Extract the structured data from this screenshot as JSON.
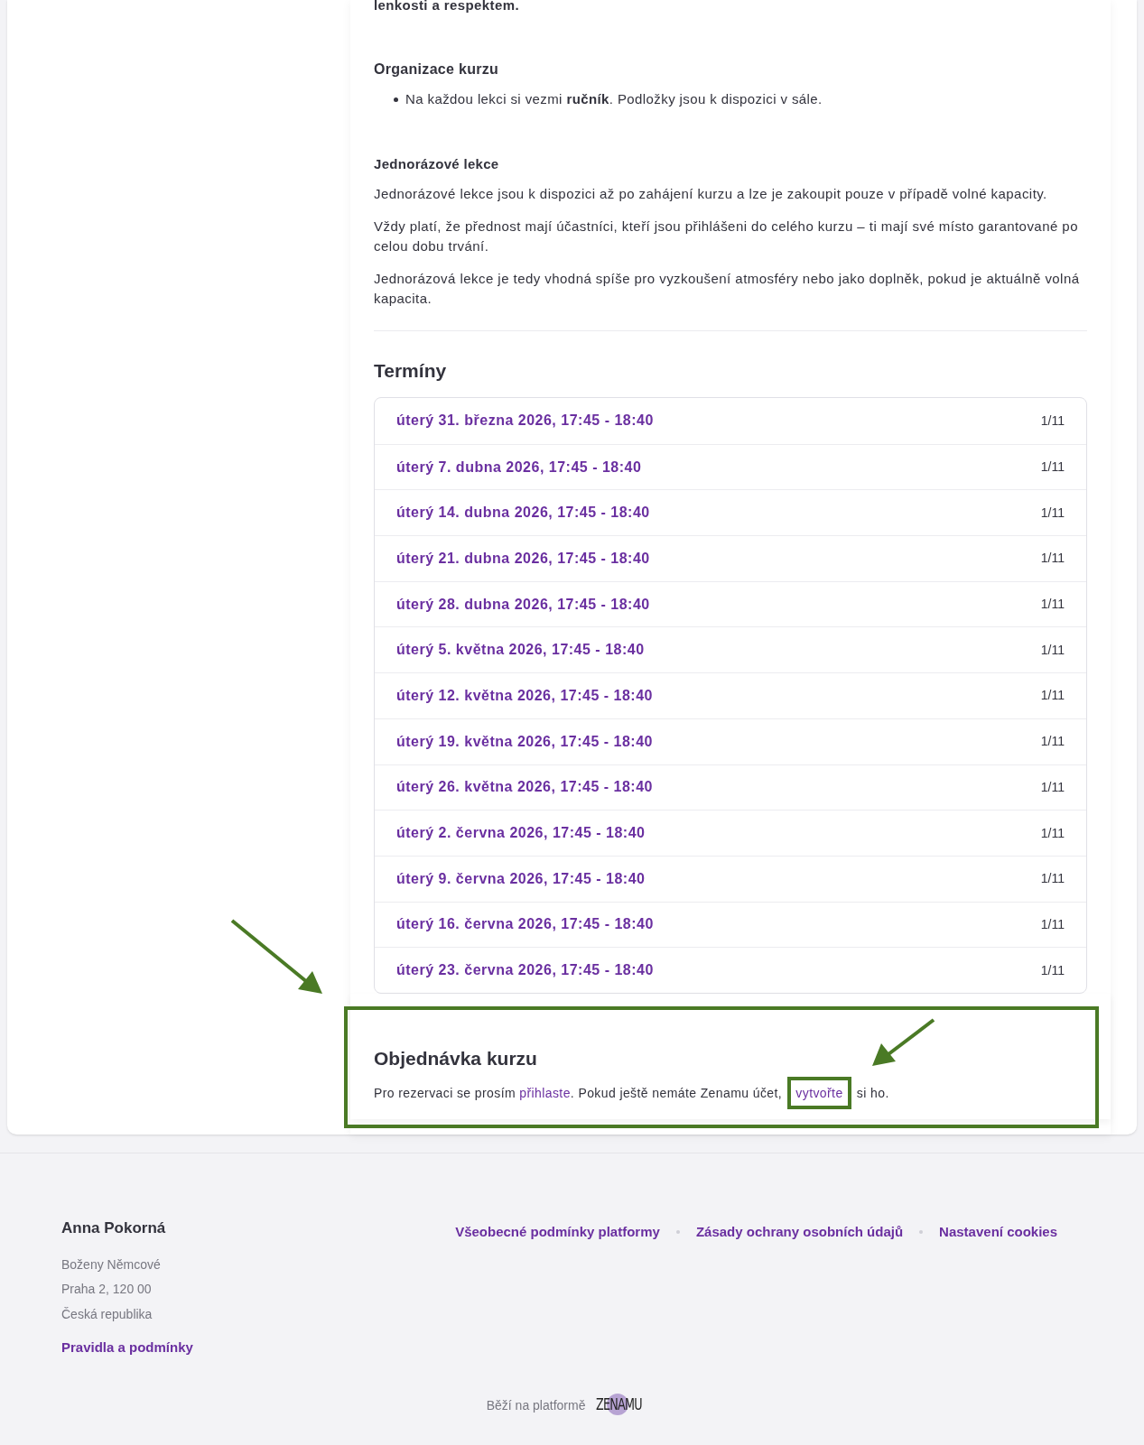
{
  "description": {
    "cut_line": "lenkosti a respektem.",
    "sections": [
      {
        "heading": "Organizace kurzu",
        "kind": "list",
        "items": [
          "Na každou lekci si vezmi **ručník**. Podložky jsou k dispozici v sále."
        ]
      },
      {
        "heading": "Jednorázové lekce",
        "kind": "paragraphs",
        "items": [
          "Jednorázové lekce jsou k dispozici až po zahájení kurzu a lze je zakoupit pouze v případě volné kapacity.",
          "Vždy platí, že přednost mají účastníci, kteří jsou přihlášeni do celého kurzu – ti mají své místo garantované po celou dobu trvání.",
          "Jednorázová lekce je tedy vhodná spíše pro vyzkoušení atmosféry nebo jako doplněk, pokud je aktuálně volná kapacita."
        ]
      }
    ]
  },
  "terms": {
    "title": "Termíny",
    "rows": [
      {
        "date": "úterý 31. března 2026, 17:45 - 18:40",
        "capacity": "1/11"
      },
      {
        "date": "úterý 7. dubna 2026, 17:45 - 18:40",
        "capacity": "1/11"
      },
      {
        "date": "úterý 14. dubna 2026, 17:45 - 18:40",
        "capacity": "1/11"
      },
      {
        "date": "úterý 21. dubna 2026, 17:45 - 18:40",
        "capacity": "1/11"
      },
      {
        "date": "úterý 28. dubna 2026, 17:45 - 18:40",
        "capacity": "1/11"
      },
      {
        "date": "úterý 5. května 2026, 17:45 - 18:40",
        "capacity": "1/11"
      },
      {
        "date": "úterý 12. května 2026, 17:45 - 18:40",
        "capacity": "1/11"
      },
      {
        "date": "úterý 19. května 2026, 17:45 - 18:40",
        "capacity": "1/11"
      },
      {
        "date": "úterý 26. května 2026, 17:45 - 18:40",
        "capacity": "1/11"
      },
      {
        "date": "úterý 2. června 2026, 17:45 - 18:40",
        "capacity": "1/11"
      },
      {
        "date": "úterý 9. června 2026, 17:45 - 18:40",
        "capacity": "1/11"
      },
      {
        "date": "úterý 16. června 2026, 17:45 - 18:40",
        "capacity": "1/11"
      },
      {
        "date": "úterý 23. června 2026, 17:45 - 18:40",
        "capacity": "1/11"
      }
    ]
  },
  "order": {
    "title": "Objednávka kurzu",
    "parts": [
      {
        "kind": "text",
        "text": "Pro rezervaci se prosím "
      },
      {
        "kind": "link",
        "text": "přihlaste",
        "highlighted": false
      },
      {
        "kind": "text",
        "text": ". Pokud ještě nemáte Zenamu účet, "
      },
      {
        "kind": "link",
        "text": "vytvořte",
        "highlighted": true
      },
      {
        "kind": "text",
        "text": " si ho."
      }
    ]
  },
  "footer": {
    "name": "Anna Pokorná",
    "address": [
      "Boženy Němcové",
      "Praha 2, 120 00",
      "Česká republika"
    ],
    "rules_link": "Pravidla a podmínky",
    "links": [
      "Všeobecné podmínky platformy",
      "Zásady ochrany osobních údajů",
      "Nastavení cookies"
    ],
    "powered_by": "Běží na platformě",
    "logo": "ZENAMU"
  }
}
